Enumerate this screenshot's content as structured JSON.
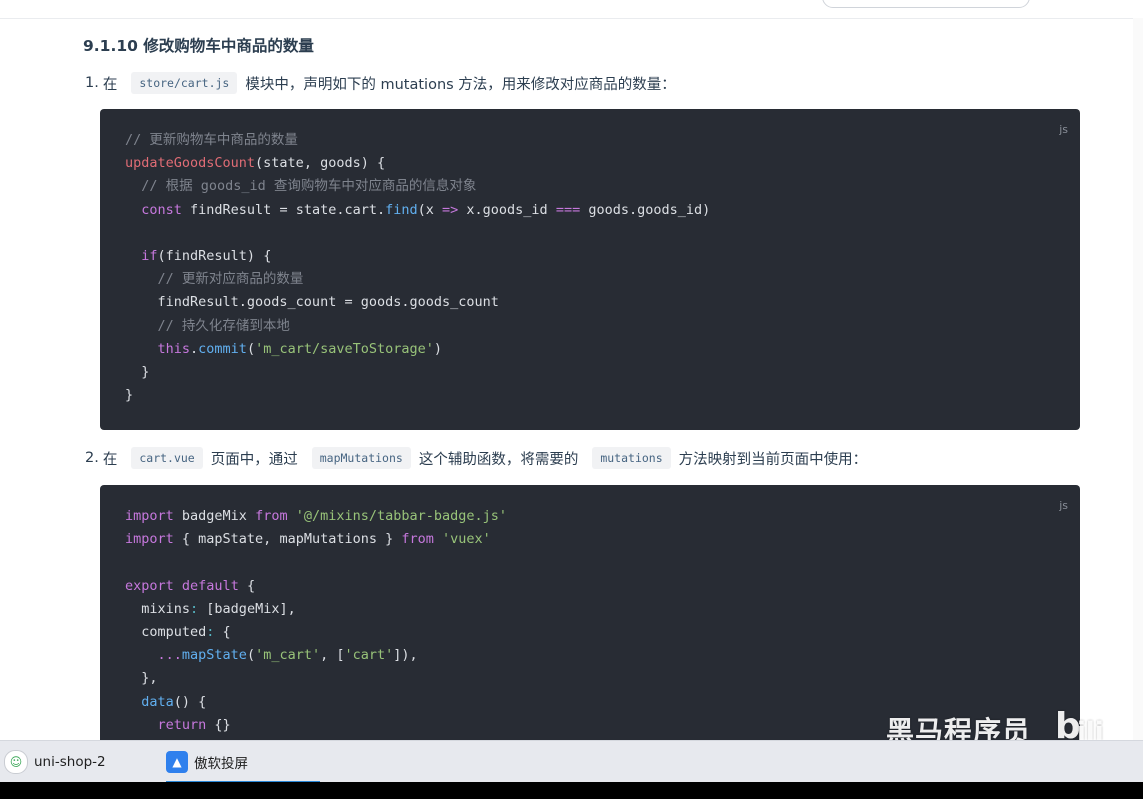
{
  "heading": "9.1.10 修改购物车中商品的数量",
  "step1": {
    "num": "1.",
    "pre": "在",
    "code": "store/cart.js",
    "post": "模块中，声明如下的 mutations 方法，用来修改对应商品的数量："
  },
  "code1": {
    "lang": "js",
    "lines": [
      "// 更新购物车中商品的数量",
      "updateGoodsCount(state, goods) {",
      "  // 根据 goods_id 查询购物车中对应商品的信息对象",
      "  const findResult = state.cart.find(x => x.goods_id === goods.goods_id)",
      "",
      "  if(findResult) {",
      "    // 更新对应商品的数量",
      "    findResult.goods_count = goods.goods_count",
      "    // 持久化存储到本地",
      "    this.commit('m_cart/saveToStorage')",
      "  }",
      "}"
    ]
  },
  "step2": {
    "num": "2.",
    "pre": "在",
    "code1": "cart.vue",
    "mid1": "页面中，通过",
    "code2": "mapMutations",
    "mid2": "这个辅助函数，将需要的",
    "code3": "mutations",
    "post": "方法映射到当前页面中使用："
  },
  "code2": {
    "lang": "js",
    "lines": [
      "import badgeMix from '@/mixins/tabbar-badge.js'",
      "import { mapState, mapMutations } from 'vuex'",
      "",
      "export default {",
      "  mixins: [badgeMix],",
      "  computed: {",
      "    ...mapState('m_cart', ['cart']),",
      "  },",
      "  data() {",
      "    return {}"
    ]
  },
  "taskbar": {
    "items": [
      {
        "label": "uni-shop-2",
        "icon": "wechat-devtools-icon"
      },
      {
        "label": "傲软投屏",
        "icon": "apowermirror-icon"
      }
    ]
  },
  "watermark": {
    "text": "黑马程序员",
    "logo": "bilibili"
  },
  "colors": {
    "code_bg": "#282c34",
    "comment": "#7f848e",
    "keyword": "#c678dd",
    "function": "#e06c75",
    "string": "#98c379",
    "accent": "#2b88d8"
  }
}
